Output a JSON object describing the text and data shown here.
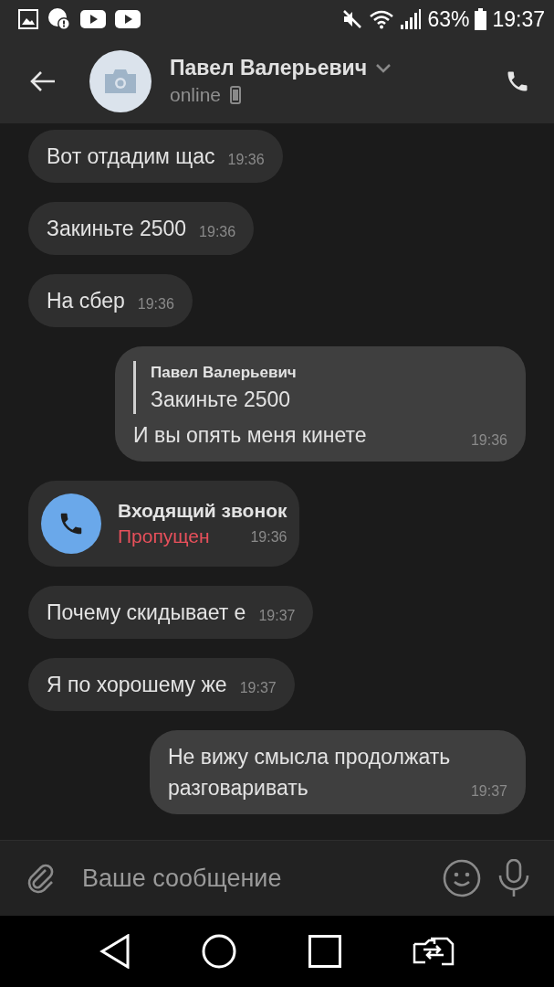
{
  "status_bar": {
    "battery": "63%",
    "time": "19:37"
  },
  "header": {
    "name": "Павел Валерьевич",
    "presence": "online"
  },
  "messages": [
    {
      "kind": "text",
      "outgoing": false,
      "text": "Вот отдадим щас",
      "time": "19:36"
    },
    {
      "kind": "text",
      "outgoing": false,
      "text": "Закиньте 2500",
      "time": "19:36"
    },
    {
      "kind": "text",
      "outgoing": false,
      "text": "На сбер",
      "time": "19:36"
    },
    {
      "kind": "reply",
      "outgoing": true,
      "quote_author": "Павел Валерьевич",
      "quote_text": "Закиньте 2500",
      "text": "И вы опять меня кинете",
      "time": "19:36"
    },
    {
      "kind": "call",
      "outgoing": false,
      "title": "Входящий звонок",
      "status": "Пропущен",
      "time": "19:36"
    },
    {
      "kind": "text",
      "outgoing": false,
      "text": "Почему скидывает е",
      "time": "19:37"
    },
    {
      "kind": "text",
      "outgoing": false,
      "text": "Я по хорошему же",
      "time": "19:37"
    },
    {
      "kind": "text",
      "outgoing": true,
      "text": "Не вижу смысла продолжать разговаривать",
      "time": "19:37"
    }
  ],
  "composer": {
    "placeholder": "Ваше сообщение"
  }
}
